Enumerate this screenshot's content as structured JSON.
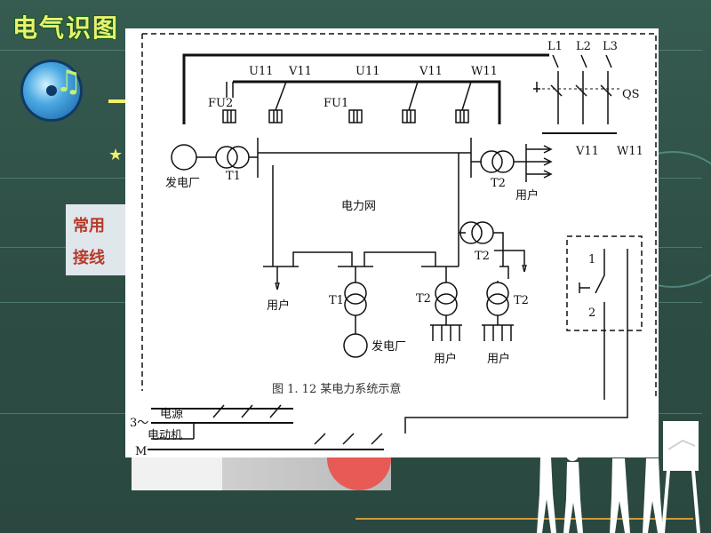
{
  "slide": {
    "title": "电气识图",
    "text_lines": [
      "常用",
      "接线"
    ]
  },
  "diagram": {
    "caption": "图 1. 12   某电力系统示意",
    "labels": {
      "L1": "L1",
      "L2": "L2",
      "L3": "L3",
      "QS": "QS",
      "U11_a": "U11",
      "V11_a": "V11",
      "U11_b": "U11",
      "V11_b": "V11",
      "W11": "W11",
      "FU2": "FU2",
      "FU1": "FU1",
      "V11_c": "V11",
      "W11_c": "W11",
      "gen1": "发电厂",
      "T1_a": "T1",
      "T2_a": "T2",
      "user_a": "用户",
      "grid": "电力网",
      "T2_b": "T2",
      "user_b": "用户",
      "T1_b": "T1",
      "T2_c": "T2",
      "T2_d": "T2",
      "gen2": "发电厂",
      "user_c": "用户",
      "user_d": "用户",
      "sw1": "1",
      "sw2": "2",
      "three_phase": "3～",
      "power_source": "电源",
      "motor": "电动机",
      "M": "M"
    }
  },
  "colors": {
    "background": "#2e4f45",
    "title": "#e9f16e",
    "text_box_text": "#b7392a",
    "accent_line": "#e2a33a"
  }
}
